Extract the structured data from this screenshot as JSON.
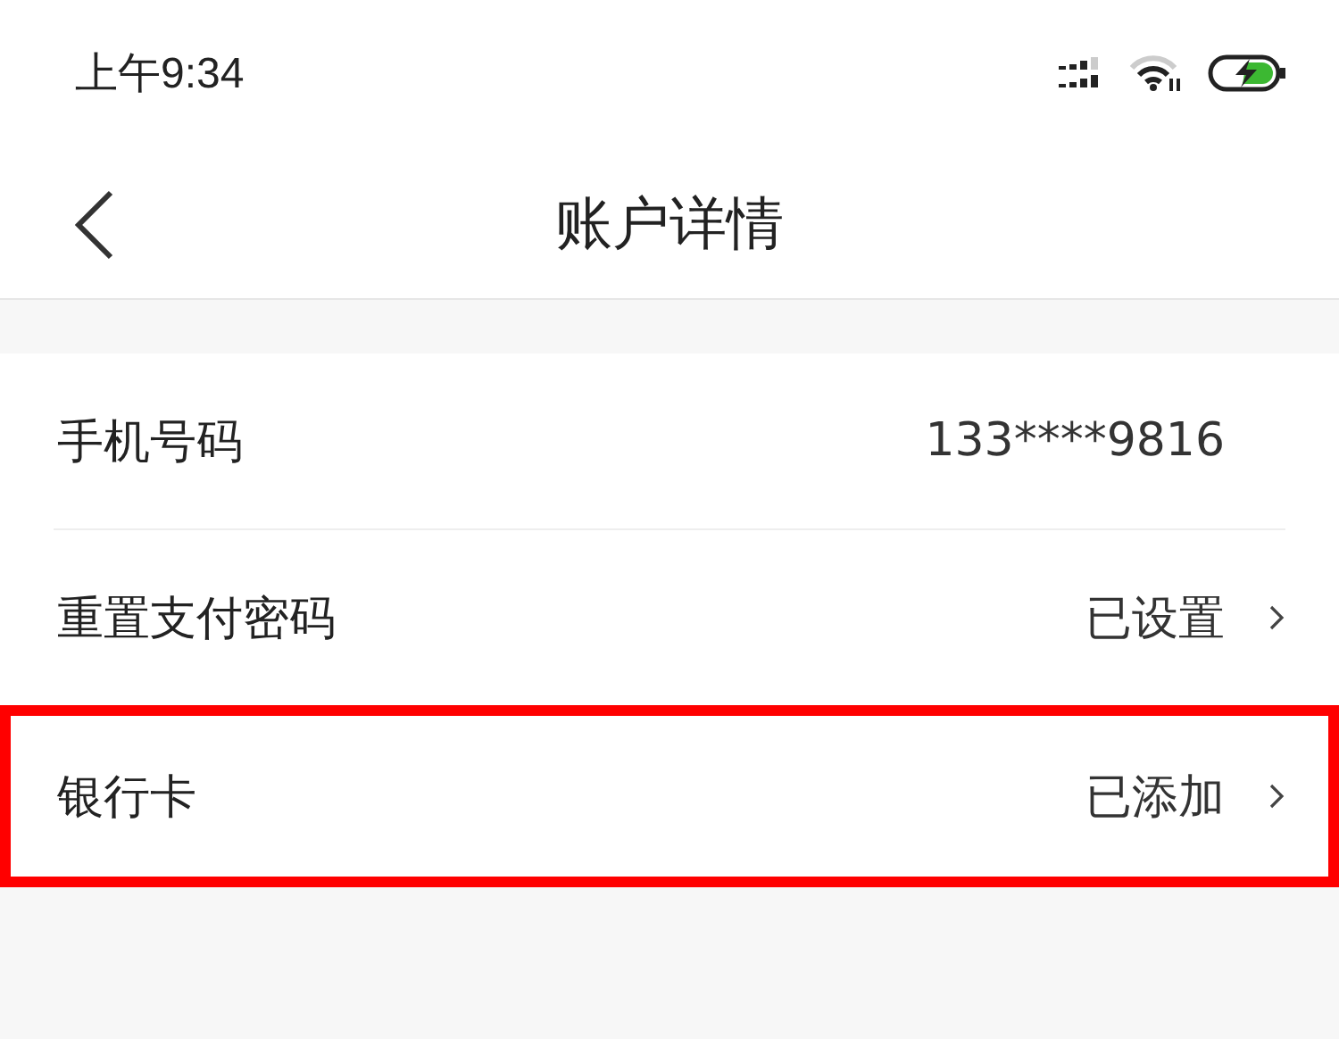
{
  "status_bar": {
    "time": "上午9:34"
  },
  "header": {
    "title": "账户详情"
  },
  "rows": [
    {
      "kind": "info",
      "label": "手机号码",
      "value": "133****9816",
      "highlighted": false
    },
    {
      "kind": "link",
      "label": "重置支付密码",
      "value": "已设置",
      "highlighted": false
    },
    {
      "kind": "link",
      "label": "银行卡",
      "value": "已添加",
      "highlighted": true
    }
  ]
}
